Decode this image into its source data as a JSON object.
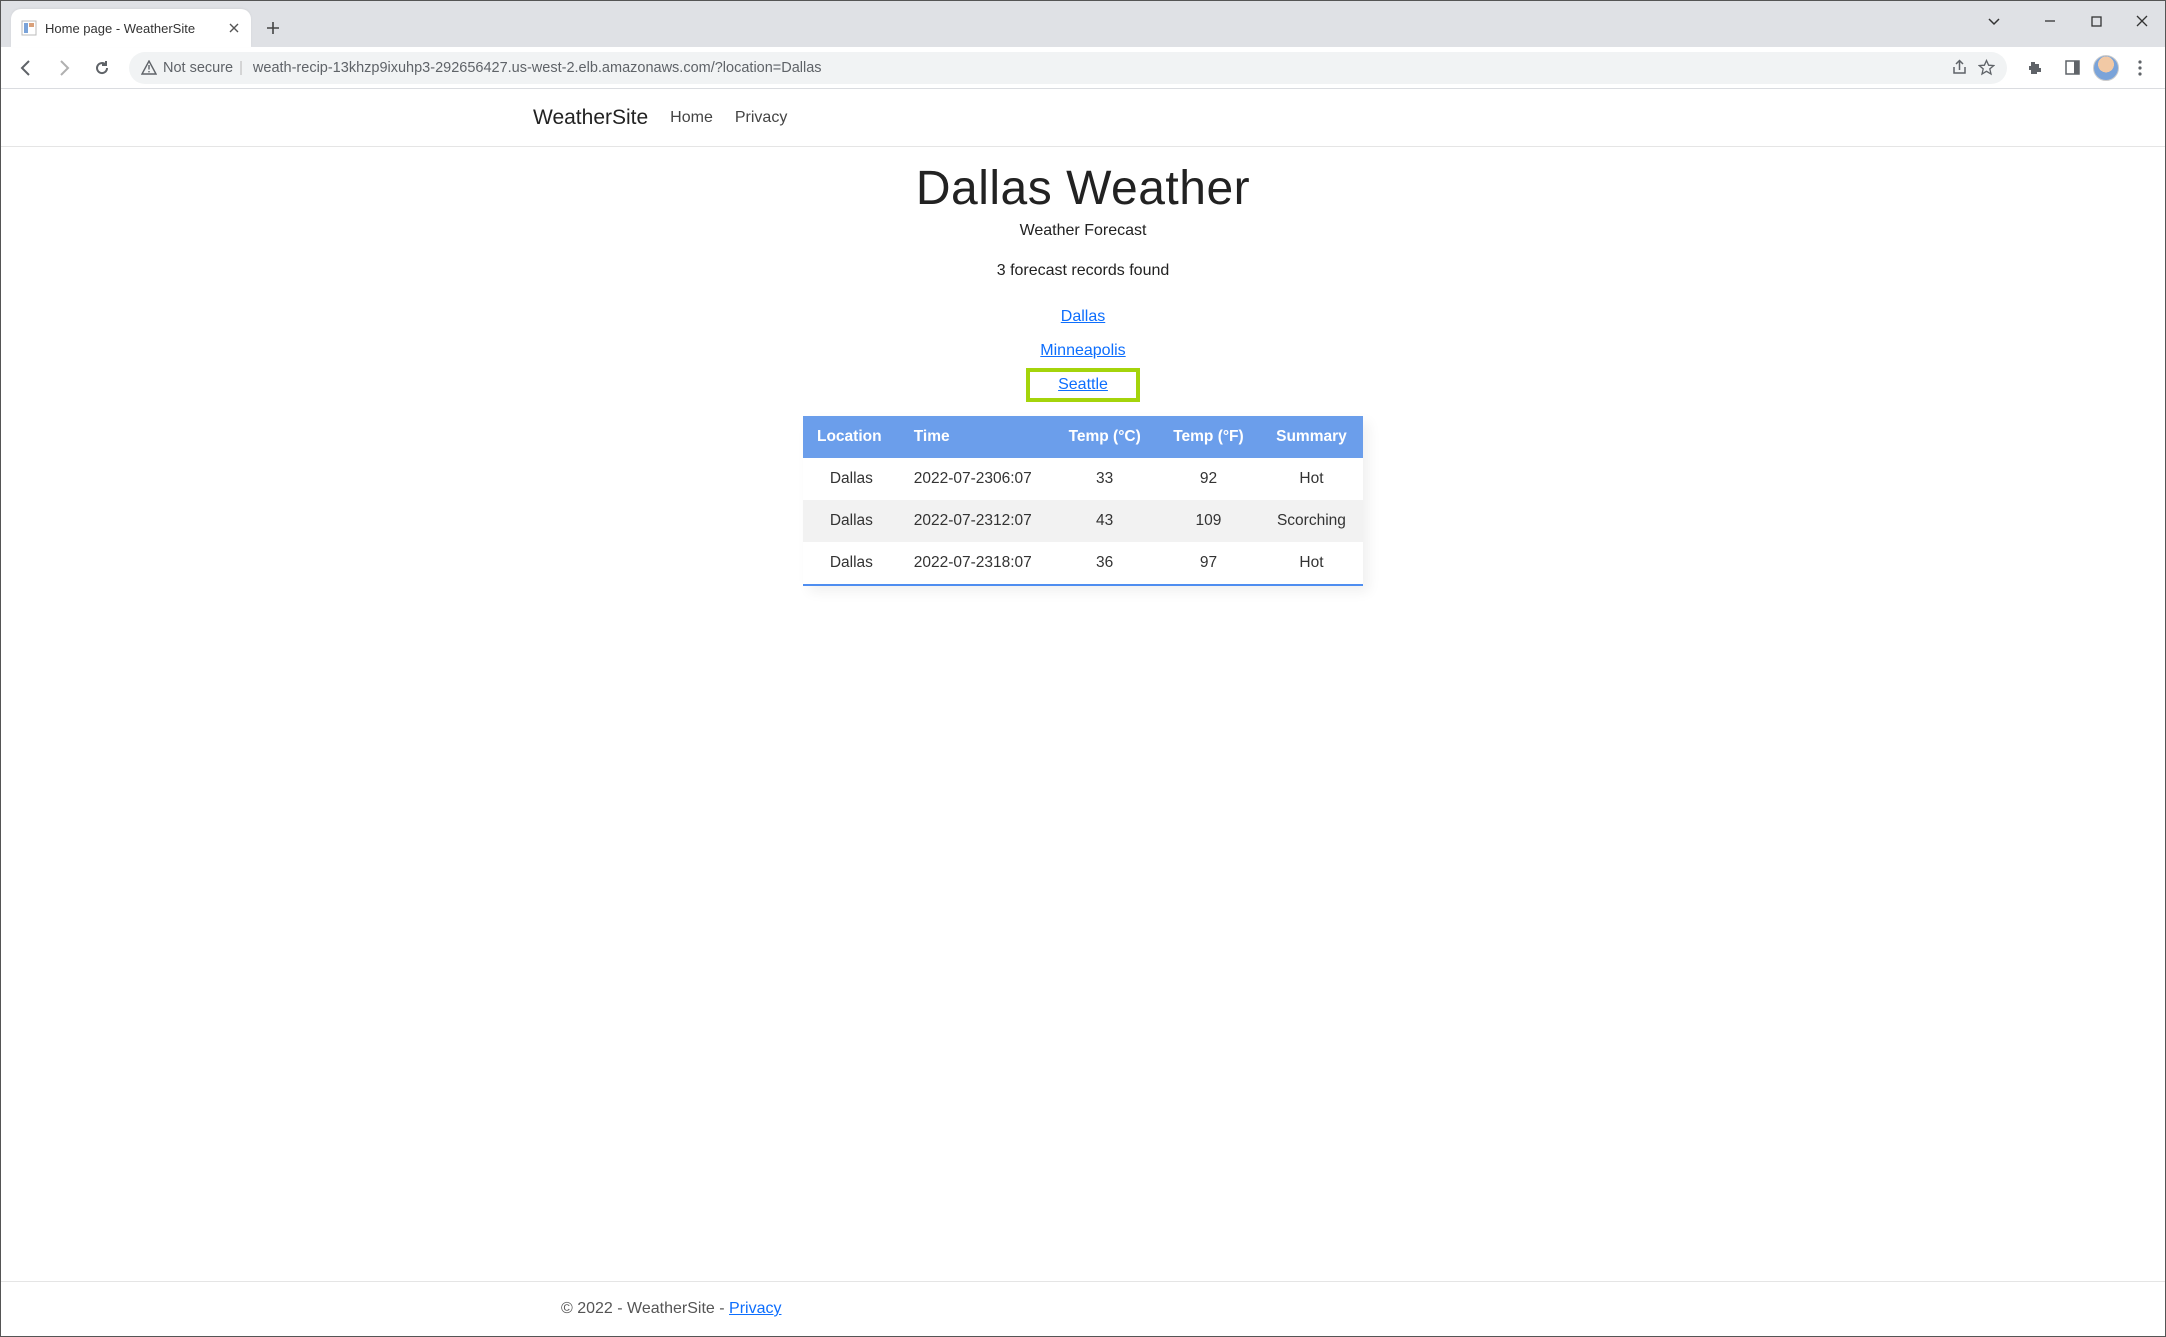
{
  "browser": {
    "tab_title": "Home page - WeatherSite",
    "not_secure_label": "Not secure",
    "url": "weath-recip-13khzp9ixuhp3-292656427.us-west-2.elb.amazonaws.com/?location=Dallas"
  },
  "nav": {
    "brand": "WeatherSite",
    "links": [
      "Home",
      "Privacy"
    ]
  },
  "page": {
    "heading": "Dallas Weather",
    "subtitle": "Weather Forecast",
    "records_found": "3 forecast records found",
    "location_links": [
      "Dallas",
      "Minneapolis",
      "Seattle"
    ],
    "highlighted_index": 2
  },
  "table": {
    "headers": [
      "Location",
      "Time",
      "Temp (°C)",
      "Temp (°F)",
      "Summary"
    ],
    "rows": [
      {
        "location": "Dallas",
        "time": "2022-07-2306:07",
        "temp_c": "33",
        "temp_f": "92",
        "summary": "Hot"
      },
      {
        "location": "Dallas",
        "time": "2022-07-2312:07",
        "temp_c": "43",
        "temp_f": "109",
        "summary": "Scorching"
      },
      {
        "location": "Dallas",
        "time": "2022-07-2318:07",
        "temp_c": "36",
        "temp_f": "97",
        "summary": "Hot"
      }
    ]
  },
  "footer": {
    "text_prefix": "© 2022 - WeatherSite - ",
    "privacy": "Privacy"
  }
}
